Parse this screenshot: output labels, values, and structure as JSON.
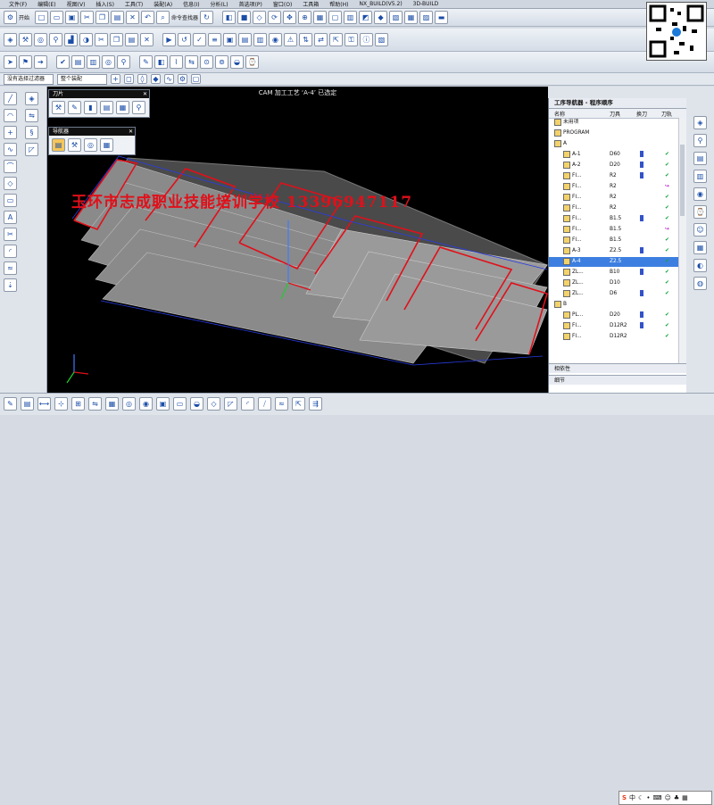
{
  "menu": [
    "文件(F)",
    "编辑(E)",
    "视图(V)",
    "插入(S)",
    "工具(T)",
    "装配(A)",
    "信息(I)",
    "分析(L)",
    "首选项(P)",
    "窗口(O)",
    "工具箱",
    "帮助(H)",
    "NX_BUILD(V5.2)",
    "3D-BUILD"
  ],
  "toolbar": {
    "start_label": "开始",
    "cmd_finder_label": "命令查找器"
  },
  "selection": {
    "filter": "没有选择过滤器",
    "assembly": "整个装配"
  },
  "viewport": {
    "status": "CAM 加工工艺 ‘A-4’ 已选定",
    "watermark": "玉环市志成职业技能培训学校 13396947117"
  },
  "floating_tool": {
    "title": "刀片"
  },
  "floating_nav": {
    "title": "导航器"
  },
  "navigator": {
    "title": "工序导航器 - 程序顺序",
    "columns": [
      "名称",
      "刀具",
      "换刀",
      "刀轨"
    ],
    "rows": [
      {
        "name": "未用项",
        "tool": "",
        "change": false,
        "path": ""
      },
      {
        "name": "PROGRAM",
        "tool": "",
        "change": false,
        "path": ""
      },
      {
        "name": "A",
        "tool": "",
        "change": false,
        "path": ""
      },
      {
        "name": "A-1",
        "tool": "D60",
        "change": true,
        "path": "check"
      },
      {
        "name": "A-2",
        "tool": "D20",
        "change": true,
        "path": "check"
      },
      {
        "name": "FI...",
        "tool": "R2",
        "change": true,
        "path": "check"
      },
      {
        "name": "FI...",
        "tool": "R2",
        "change": false,
        "path": "pending"
      },
      {
        "name": "FI...",
        "tool": "R2",
        "change": false,
        "path": "check"
      },
      {
        "name": "FI...",
        "tool": "R2",
        "change": false,
        "path": "check"
      },
      {
        "name": "FI...",
        "tool": "B1.5",
        "change": true,
        "path": "check"
      },
      {
        "name": "FI...",
        "tool": "B1.5",
        "change": false,
        "path": "pending"
      },
      {
        "name": "FI...",
        "tool": "B1.5",
        "change": false,
        "path": "check"
      },
      {
        "name": "A-3",
        "tool": "Z2.5",
        "change": true,
        "path": "check"
      },
      {
        "name": "A-4",
        "tool": "Z2.5",
        "change": false,
        "path": "check"
      },
      {
        "name": "ZL...",
        "tool": "B10",
        "change": true,
        "path": "check"
      },
      {
        "name": "ZL...",
        "tool": "D10",
        "change": false,
        "path": "check"
      },
      {
        "name": "ZL...",
        "tool": "D6",
        "change": true,
        "path": "check"
      },
      {
        "name": "B",
        "tool": "",
        "change": false,
        "path": ""
      },
      {
        "name": "PL...",
        "tool": "D20",
        "change": true,
        "path": "check"
      },
      {
        "name": "FI...",
        "tool": "D12R2",
        "change": true,
        "path": "check"
      },
      {
        "name": "FI...",
        "tool": "D12R2",
        "change": false,
        "path": "check"
      }
    ],
    "selected_index": 13,
    "panes": [
      "相依性",
      "细节"
    ]
  },
  "ime": {
    "label": "中"
  }
}
